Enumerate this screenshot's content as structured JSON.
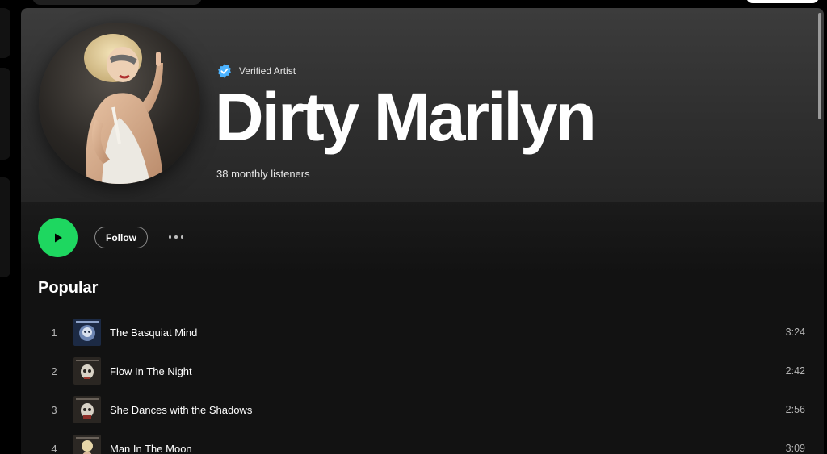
{
  "artist": {
    "verified_label": "Verified Artist",
    "name": "Dirty Marilyn",
    "monthly_listeners": "38 monthly listeners"
  },
  "actions": {
    "follow_label": "Follow"
  },
  "popular": {
    "title": "Popular",
    "tracks": [
      {
        "number": "1",
        "title": "The Basquiat Mind",
        "duration": "3:24"
      },
      {
        "number": "2",
        "title": "Flow In The Night",
        "duration": "2:42"
      },
      {
        "number": "3",
        "title": "She Dances with the Shadows",
        "duration": "2:56"
      },
      {
        "number": "4",
        "title": "Man In The Moon",
        "duration": "3:09"
      }
    ]
  },
  "colors": {
    "accent": "#1ed760",
    "verified_badge": "#4cb3ff",
    "background": "#121212"
  },
  "icons": [
    "verified-badge-icon",
    "play-icon",
    "more-options-icon"
  ]
}
